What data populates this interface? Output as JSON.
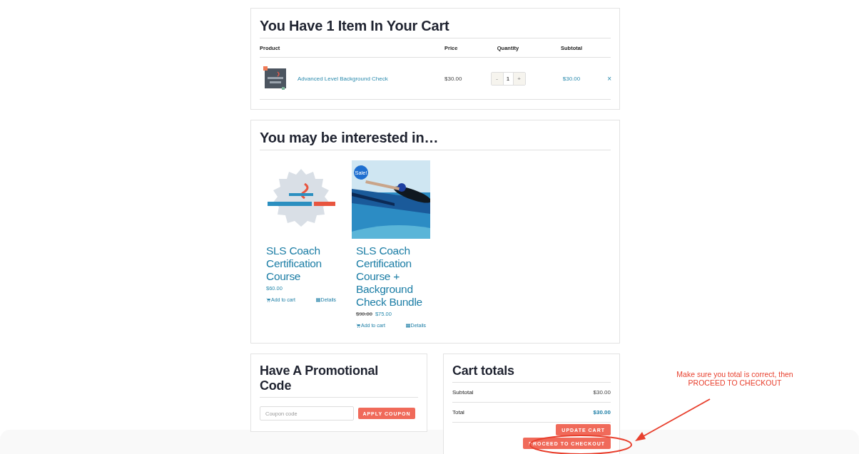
{
  "cart": {
    "title": "You Have 1 Item In Your Cart",
    "columns": [
      "Product",
      "Price",
      "Quantity",
      "Subtotal"
    ],
    "items": [
      {
        "name": "Advanced Level Background Check",
        "price": "$30.00",
        "quantity": "1",
        "minus": "-",
        "plus": "+",
        "subtotal": "$30.00",
        "remove": "×"
      }
    ]
  },
  "related": {
    "title": "You may be interested in…",
    "products": [
      {
        "title": "SLS Coach Certification Course",
        "price": "$60.00",
        "add": "Add to cart",
        "details": "Details"
      },
      {
        "title": "SLS Coach Certification Course + Background Check Bundle",
        "sale_label": "Sale!",
        "old_price": "$90.00",
        "price": "$75.00",
        "add": "Add to cart",
        "details": "Details"
      }
    ]
  },
  "coupon": {
    "title": "Have A Promotional Code",
    "placeholder": "Coupon code",
    "button": "APPLY COUPON"
  },
  "totals": {
    "title": "Cart totals",
    "rows": [
      {
        "label": "Subtotal",
        "value": "$30.00",
        "emphasis": false
      },
      {
        "label": "Total",
        "value": "$30.00",
        "emphasis": true
      }
    ],
    "update_button": "UPDATE CART",
    "checkout_button": "PROCEED TO CHECKOUT"
  },
  "annotation": {
    "lines": [
      "Make sure you total is correct, then",
      "PROCEED TO CHECKOUT"
    ]
  }
}
